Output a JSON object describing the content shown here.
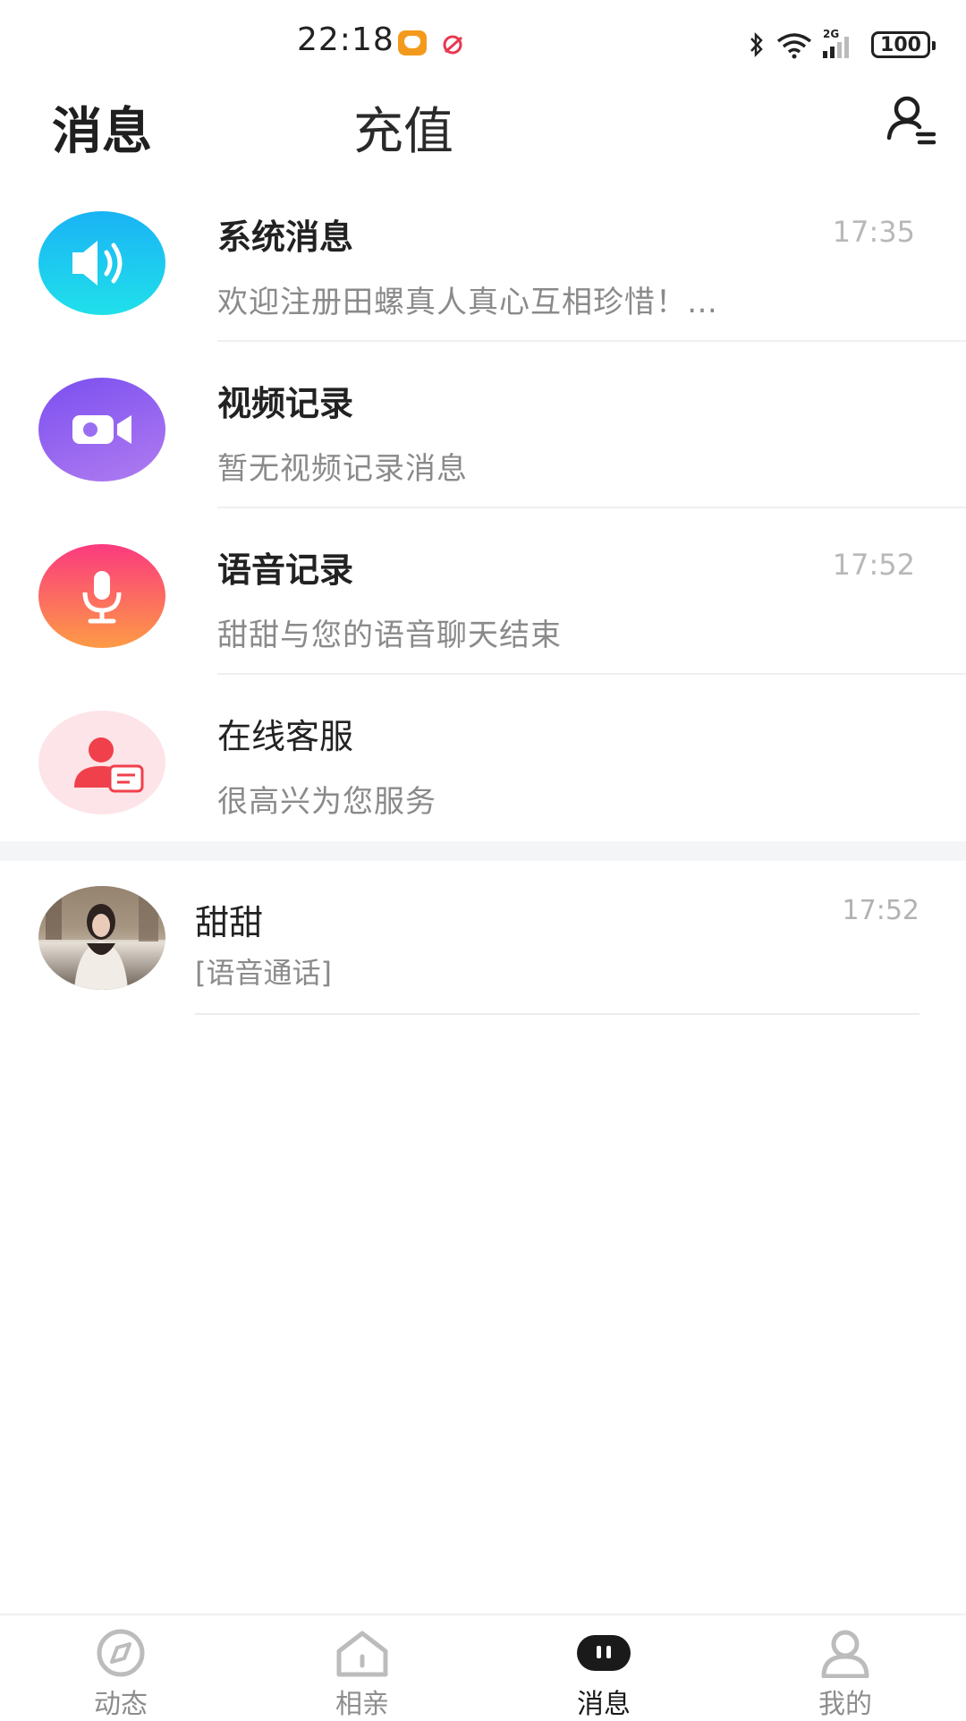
{
  "status_bar": {
    "time": "22:18",
    "icons": [
      "app-notification-icon",
      "app-notification-icon-2",
      "bluetooth-icon",
      "wifi-icon",
      "signal-icon"
    ],
    "network_label": "2G",
    "battery": "100"
  },
  "header": {
    "tab_messages": "消息",
    "tab_recharge": "充值",
    "contacts_icon": "contacts-icon"
  },
  "system_rows": [
    {
      "title": "系统消息",
      "subtitle": "欢迎注册田螺真人真心互相珍惜！…",
      "time": "17:35",
      "icon": "speaker-icon",
      "color": "#1ab3f5"
    },
    {
      "title": "视频记录",
      "subtitle": "暂无视频记录消息",
      "time": "",
      "icon": "video-camera-icon",
      "color": "#8b5cf0"
    },
    {
      "title": "语音记录",
      "subtitle": "甜甜与您的语音聊天结束",
      "time": "17:52",
      "icon": "microphone-icon",
      "color": "#fb3a7f"
    },
    {
      "title": "在线客服",
      "subtitle": "很高兴为您服务",
      "time": "",
      "icon": "customer-service-icon",
      "color": "#f0404b"
    }
  ],
  "chats": [
    {
      "name": "甜甜",
      "last_message": "[语音通话]",
      "time": "17:52"
    }
  ],
  "bottom_nav": [
    {
      "label": "动态",
      "icon": "compass-icon",
      "active": false
    },
    {
      "label": "相亲",
      "icon": "home-icon",
      "active": false
    },
    {
      "label": "消息",
      "icon": "message-bubble-icon",
      "active": true
    },
    {
      "label": "我的",
      "icon": "profile-icon",
      "active": false
    }
  ]
}
